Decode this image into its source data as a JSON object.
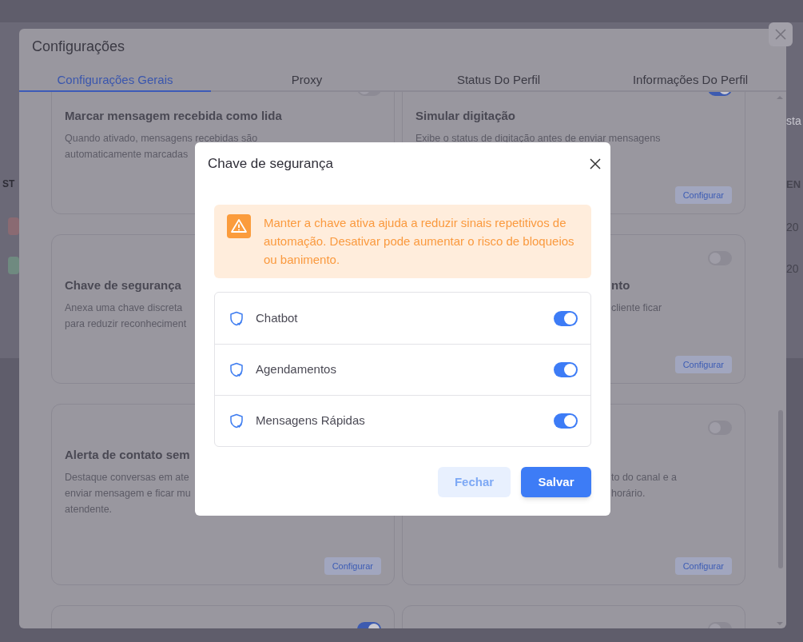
{
  "background": {
    "header_left": "ST",
    "header_right": "EN",
    "field_fragment": "sta",
    "cells": [
      "20",
      "20"
    ],
    "badges": [
      {
        "color": "#8a6a72"
      },
      {
        "color": "#6f8a80"
      }
    ]
  },
  "settings": {
    "title": "Configurações",
    "tabs": [
      {
        "label": "Configurações Gerais",
        "selected": true
      },
      {
        "label": "Proxy",
        "selected": false
      },
      {
        "label": "Status Do Perfil",
        "selected": false
      },
      {
        "label": "Informações Do Perfil",
        "selected": false
      }
    ],
    "cards": [
      {
        "toggle_on": false,
        "title": "Marcar mensagem recebida como lida",
        "description": [
          "Quando ativado, mensagens recebidas são",
          "automaticamente marcadas"
        ]
      },
      {
        "toggle_on": true,
        "title": "Simular digitação",
        "description": [
          "Exibe o status de digitação antes de enviar mensagens"
        ],
        "button": "Configurar"
      },
      {
        "title": "Chave de segurança",
        "description": [
          "Anexa uma chave discreta",
          "para reduzir reconheciment"
        ]
      },
      {
        "toggle_on": false,
        "title": "nto",
        "description": [
          "cliente ficar"
        ],
        "button": "Configurar"
      },
      {
        "title": "Alerta de contato sem",
        "description": [
          "Destaque conversas em ate",
          "enviar mensagem e ficar mu",
          "atendente."
        ],
        "button": "Configurar"
      },
      {
        "toggle_on": false,
        "description": [
          "to do canal e a",
          "horário."
        ],
        "button": "Configurar"
      },
      {
        "toggle_on": true
      },
      {
        "toggle_on": false
      }
    ]
  },
  "dialog": {
    "title": "Chave de segurança",
    "alert": "Manter a chave ativa ajuda a reduzir sinais repetitivos de automação. Desativar pode aumentar o risco de bloqueios ou banimento.",
    "options": [
      {
        "label": "Chatbot",
        "on": true
      },
      {
        "label": "Agendamentos",
        "on": true
      },
      {
        "label": "Mensagens Rápidas",
        "on": true
      }
    ],
    "buttons": [
      {
        "label": "Fechar",
        "kind": "secondary"
      },
      {
        "label": "Salvar",
        "kind": "primary"
      }
    ]
  }
}
